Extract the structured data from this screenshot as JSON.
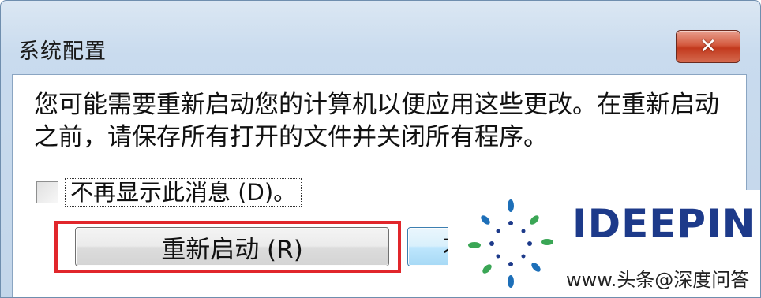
{
  "window": {
    "title": "系统配置",
    "close_icon": "close-icon"
  },
  "message": {
    "text": "您可能需要重新启动您的计算机以便应用这些更改。在重新启动之前，请保存所有打开的文件并关闭所有程序。"
  },
  "checkbox": {
    "label": "不再显示此消息 (D)。",
    "checked": false
  },
  "buttons": {
    "restart_label": "重新启动 (R)",
    "partial_label": "不"
  },
  "highlight": {
    "color": "#e1262b"
  },
  "watermark": {
    "brand": "IDEEPIN",
    "site": "www.头条@深度问答"
  }
}
